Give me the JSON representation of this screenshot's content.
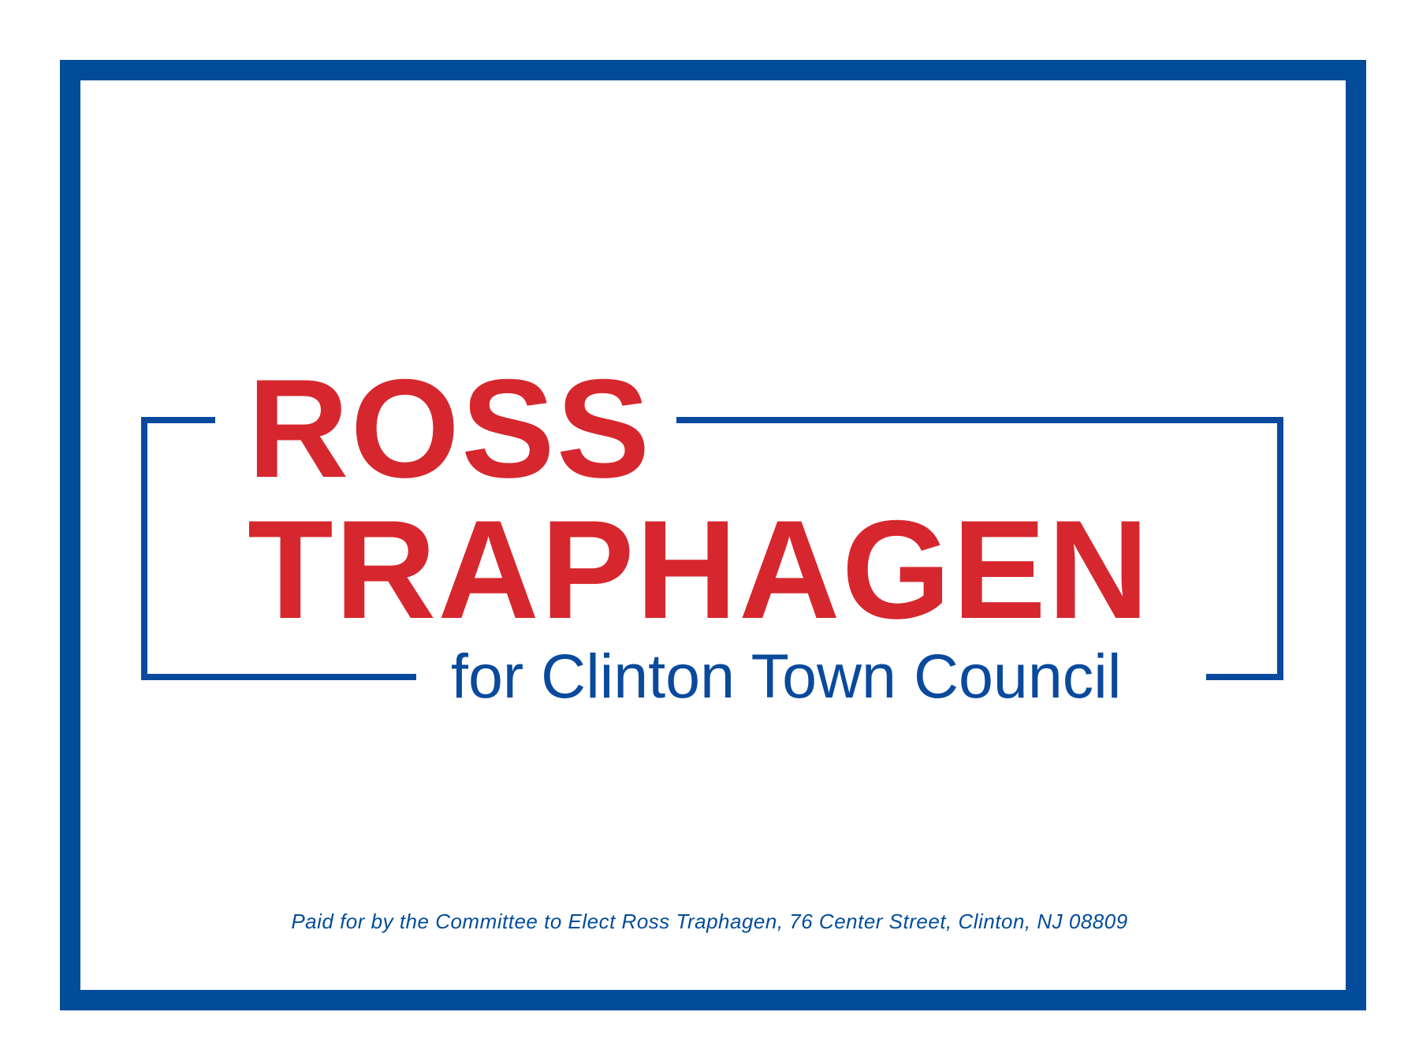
{
  "sign": {
    "first_name": "ROSS",
    "last_name": "TRAPHAGEN",
    "office": "for Clinton Town Council",
    "disclaimer": "Paid for by the Committee to Elect Ross Traphagen, 76 Center Street, Clinton, NJ 08809"
  },
  "colors": {
    "border_blue": "#024c99",
    "text_blue": "#0a4a9c",
    "name_red": "#d6272e",
    "background": "#ffffff"
  }
}
